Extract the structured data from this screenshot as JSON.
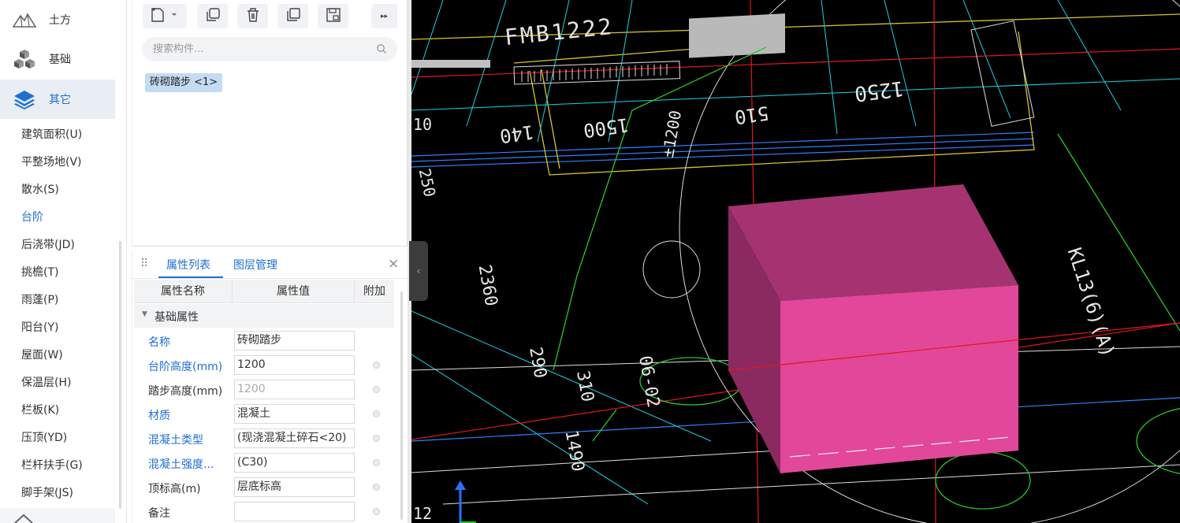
{
  "sidebar": {
    "categories": [
      {
        "label": "土方",
        "icon": "earthwork-icon",
        "active": false
      },
      {
        "label": "基础",
        "icon": "foundation-icon",
        "active": false
      },
      {
        "label": "其它",
        "icon": "layers-icon",
        "active": true
      }
    ],
    "sub_items": [
      {
        "label": "建筑面积(U)",
        "active": false
      },
      {
        "label": "平整场地(V)",
        "active": false
      },
      {
        "label": "散水(S)",
        "active": false
      },
      {
        "label": "台阶",
        "active": true
      },
      {
        "label": "后浇带(JD)",
        "active": false
      },
      {
        "label": "挑檐(T)",
        "active": false
      },
      {
        "label": "雨蓬(P)",
        "active": false
      },
      {
        "label": "阳台(Y)",
        "active": false
      },
      {
        "label": "屋面(W)",
        "active": false
      },
      {
        "label": "保温层(H)",
        "active": false
      },
      {
        "label": "栏板(K)",
        "active": false
      },
      {
        "label": "压顶(YD)",
        "active": false
      },
      {
        "label": "栏杆扶手(G)",
        "active": false
      },
      {
        "label": "脚手架(JS)",
        "active": false
      }
    ]
  },
  "component_panel": {
    "toolbar": [
      "new-component-icon",
      "copy-icon",
      "delete-icon",
      "layer-copy-icon",
      "save-template-icon",
      "more-icon"
    ],
    "search_placeholder": "搜索构件...",
    "components": [
      {
        "label": "砖砌踏步 <1>",
        "selected": true
      }
    ]
  },
  "property_panel": {
    "tabs": {
      "attributes": "属性列表",
      "layers": "图层管理"
    },
    "close": "×",
    "columns": {
      "name": "属性名称",
      "value": "属性值",
      "extra": "附加"
    },
    "group": "基础属性",
    "rows": [
      {
        "name": "名称",
        "value": "砖砌踏步",
        "name_blue": true,
        "value_gray": false,
        "has_dot": false
      },
      {
        "name": "台阶高度(mm)",
        "value": "1200",
        "name_blue": true,
        "value_gray": false,
        "has_dot": true
      },
      {
        "name": "踏步高度(mm)",
        "value": "1200",
        "name_blue": false,
        "value_gray": true,
        "has_dot": true
      },
      {
        "name": "材质",
        "value": "混凝土",
        "name_blue": true,
        "value_gray": false,
        "has_dot": true
      },
      {
        "name": "混凝土类型",
        "value": "(现浇混凝土碎石<20)",
        "name_blue": true,
        "value_gray": false,
        "has_dot": true
      },
      {
        "name": "混凝土强度...",
        "value": "(C30)",
        "name_blue": true,
        "value_gray": false,
        "has_dot": true
      },
      {
        "name": "顶标高(m)",
        "value": "层底标高",
        "name_blue": false,
        "value_gray": false,
        "has_dot": true
      },
      {
        "name": "备注",
        "value": "",
        "name_blue": false,
        "value_gray": false,
        "has_dot": true
      }
    ]
  },
  "cad_view": {
    "labels": {
      "door_tag": "FMB1222",
      "dim_1250": "1250",
      "dim_510": "510",
      "row_10": "10",
      "row_12": "12",
      "dim_1490": "1490",
      "dim_310": "310",
      "dim_2360": "2360",
      "dim_290": "290",
      "level_1200": "±1200",
      "dim_1500": "1500",
      "dim_140": "140",
      "dim_250": "250",
      "beam_tag": "KL13(6)(A)",
      "detail_tag": "06-02"
    },
    "colors": {
      "step_front": "#e2479a",
      "step_top": "#a53372",
      "step_side": "#c43a86",
      "background": "#000000"
    }
  }
}
